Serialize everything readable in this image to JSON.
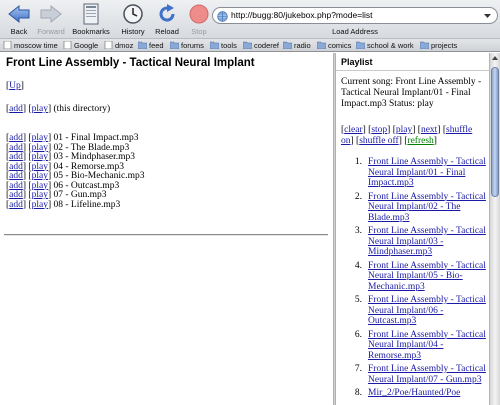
{
  "toolbar": {
    "back": "Back",
    "forward": "Forward",
    "bookmarks": "Bookmarks",
    "history": "History",
    "reload": "Reload",
    "stop": "Stop",
    "address": "http://bugg:80/jukebox.php?mode=list",
    "load_address": "Load Address"
  },
  "bookmarks_bar": [
    "moscow time",
    "Google",
    "dmoz",
    "feed",
    "forums",
    "tools",
    "coderef",
    "radio",
    "comics",
    "school & work",
    "projects"
  ],
  "main": {
    "title": "Front Line Assembly - Tactical Neural Implant",
    "up": "Up",
    "add": "add",
    "play": "play",
    "this_directory": "(this directory)",
    "tracks": [
      "01 - Final Impact.mp3",
      "02 - The Blade.mp3",
      "03 - Mindphaser.mp3",
      "04 - Remorse.mp3",
      "05 - Bio-Mechanic.mp3",
      "06 - Outcast.mp3",
      "07 - Gun.mp3",
      "08 - Lifeline.mp3"
    ]
  },
  "playlist": {
    "title": "Playlist",
    "current_song": "Current song: Front Line Assembly - Tactical Neural Implant/01 - Final Impact.mp3 Status: play",
    "controls": {
      "clear": "clear",
      "stop": "stop",
      "play": "play",
      "next": "next",
      "shuffle_on": "shuffle on",
      "shuffle_off": "shuffle off",
      "refresh": "refresh"
    },
    "items": [
      {
        "num": "1.",
        "text": "Front Line Assembly - Tactical Neural Implant/01 - Final Impact.mp3"
      },
      {
        "num": "2.",
        "text": "Front Line Assembly - Tactical Neural Implant/02 - The Blade.mp3"
      },
      {
        "num": "3.",
        "text": "Front Line Assembly - Tactical Neural Implant/03 - Mindphaser.mp3"
      },
      {
        "num": "4.",
        "text": "Front Line Assembly - Tactical Neural Implant/05 - Bio-Mechanic.mp3"
      },
      {
        "num": "5.",
        "text": "Front Line Assembly - Tactical Neural Implant/06 - Outcast.mp3"
      },
      {
        "num": "6.",
        "text": "Front Line Assembly - Tactical Neural Implant/04 - Remorse.mp3"
      },
      {
        "num": "7.",
        "text": "Front Line Assembly - Tactical Neural Implant/07 - Gun.mp3"
      },
      {
        "num": "8.",
        "text": "Mir_2/Poe/Haunted/Poe"
      }
    ]
  },
  "colors": {
    "link": "#1a1aa6",
    "visited_link": "#008000",
    "stop_icon": "#e86a6a"
  }
}
